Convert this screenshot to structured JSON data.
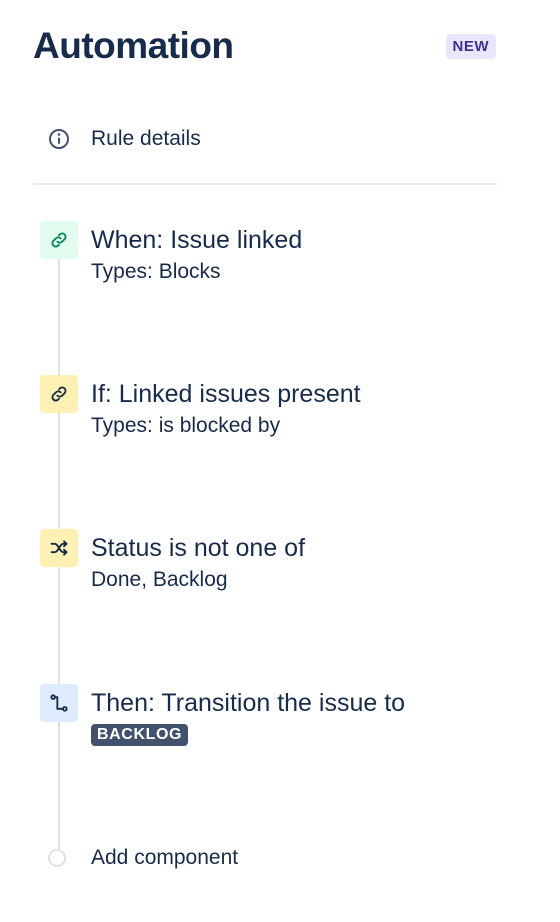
{
  "header": {
    "title": "Automation",
    "badge": "NEW"
  },
  "rule_details": {
    "label": "Rule details",
    "icon": "info-icon"
  },
  "steps": [
    {
      "heading": "When: Issue linked",
      "sub": "Types: Blocks",
      "icon": "link-icon",
      "icon_bg": "#e3fcef",
      "icon_color": "#00875a"
    },
    {
      "heading": "If: Linked issues present",
      "sub": "Types: is blocked by",
      "icon": "link-icon",
      "icon_bg": "#fff0b3",
      "icon_color": "#172b4d"
    },
    {
      "heading": "Status is not one of",
      "sub": "Done, Backlog",
      "icon": "shuffle-icon",
      "icon_bg": "#fff0b3",
      "icon_color": "#172b4d"
    },
    {
      "heading": "Then: Transition the issue to",
      "lozenge": "BACKLOG",
      "icon": "transition-icon",
      "icon_bg": "#deebff",
      "icon_color": "#172b4d"
    }
  ],
  "add_component": {
    "label": "Add component"
  },
  "colors": {
    "text": "#172b4d",
    "badge_bg": "#eae6ff",
    "badge_text": "#403294",
    "lozenge_bg": "#42526e",
    "timeline": "#dfe1e6"
  }
}
